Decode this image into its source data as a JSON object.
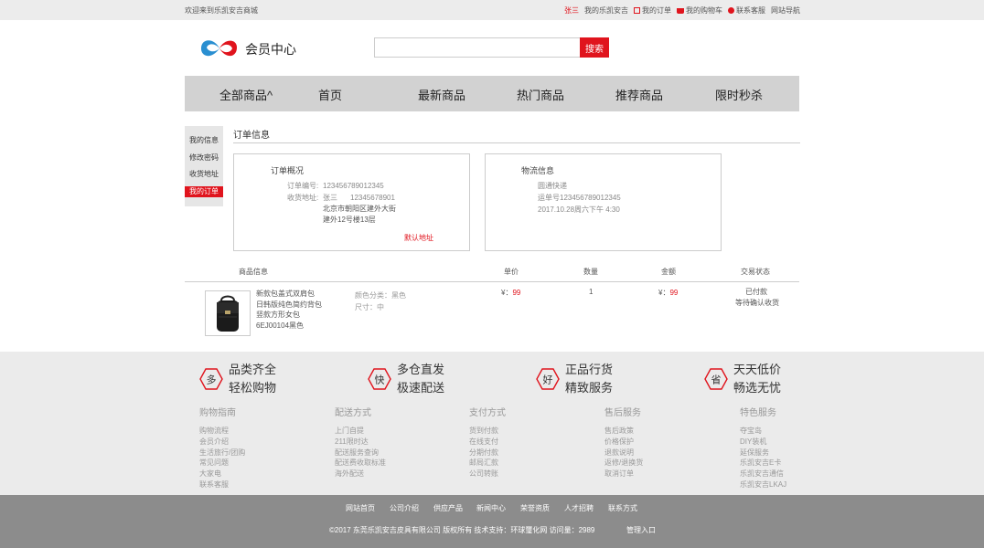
{
  "topbar": {
    "welcome": "欢迎来到乐凯安吉商城",
    "user": "张三",
    "my_store": "我的乐凯安吉",
    "my_orders": "我的订单",
    "my_cart": "我的购物车",
    "contact_service": "联系客服",
    "site_nav": "网站导航"
  },
  "header": {
    "logo_text": "会员中心",
    "search_placeholder": "",
    "search_label": "搜索"
  },
  "nav": {
    "items": [
      "全部商品^",
      "首页",
      "最新商品",
      "热门商品",
      "推荐商品",
      "限时秒杀"
    ]
  },
  "sidebar": {
    "items": [
      "我的信息",
      "修改密码",
      "收货地址",
      "我的订单"
    ]
  },
  "main": {
    "title": "订单信息",
    "overview": {
      "heading": "订单概况",
      "order_no_label": "订单编号:",
      "order_no": "123456789012345",
      "address_label": "收货地址:",
      "receiver": "张三",
      "phone": "12345678901",
      "address_line1": "北京市朝阳区建外大街",
      "address_line2": "建外12号楼13层",
      "default_tag": "默认地址"
    },
    "logistics": {
      "heading": "物流信息",
      "carrier": "圆通快递",
      "waybill": "运单号123456789012345",
      "time": "2017.10.28周六下午   4:30"
    },
    "list_headers": {
      "product": "商品信息",
      "unit_price": "单价",
      "quantity": "数量",
      "amount": "金额",
      "status": "交易状态"
    },
    "order_item": {
      "name_lines": [
        "新款包盖式双肩包",
        "日韩版纯色简约背包",
        "竖款方形女包",
        "6EJ00104黑色"
      ],
      "color_attr": "颜色分类：黑色",
      "size_attr": "尺寸：中",
      "currency": "¥：",
      "unit_price": "99",
      "quantity": "1",
      "amount": "99",
      "status_paid": "已付款",
      "status_wait": "等待确认收货"
    }
  },
  "features": [
    {
      "icon": "多",
      "line1": "品类齐全",
      "line2": "轻松购物"
    },
    {
      "icon": "快",
      "line1": "多仓直发",
      "line2": "极速配送"
    },
    {
      "icon": "好",
      "line1": "正品行货",
      "line2": "精致服务"
    },
    {
      "icon": "省",
      "line1": "天天低价",
      "line2": "畅选无忧"
    }
  ],
  "footer_columns": [
    {
      "title": "购物指南",
      "items": [
        "购物流程",
        "会员介绍",
        "生活旅行/团购",
        "常见问题",
        "大家电",
        "联系客服"
      ]
    },
    {
      "title": "配送方式",
      "items": [
        "上门自提",
        "211限时达",
        "配送服务查询",
        "配送费收取标准",
        "海外配送"
      ]
    },
    {
      "title": "支付方式",
      "items": [
        "货到付款",
        "在线支付",
        "分期付款",
        "邮局汇款",
        "公司转账"
      ]
    },
    {
      "title": "售后服务",
      "items": [
        "售后政策",
        "价格保护",
        "退款说明",
        "返修/退换货",
        "取消订单"
      ]
    },
    {
      "title": "特色服务",
      "items": [
        "夺宝岛",
        "DIY装机",
        "延保服务",
        "乐凯安吉E卡",
        "乐凯安吉通信",
        "乐凯安吉LKAJ"
      ]
    }
  ],
  "footer": {
    "links": [
      "网站首页",
      "公司介绍",
      "供应产品",
      "新闻中心",
      "荣誉资质",
      "人才招聘",
      "联系方式"
    ],
    "copyright": "©2017 东莞乐凯安吉皮具有限公司 版权所有  技术支持：环球璽化网   访问量：2989",
    "admin": "管理入口"
  },
  "colors": {
    "accent": "#e0141d",
    "nav_bg": "#d2d2d2",
    "footer_bg": "#8c8c8c",
    "logo_blue": "#2a8fd1"
  }
}
